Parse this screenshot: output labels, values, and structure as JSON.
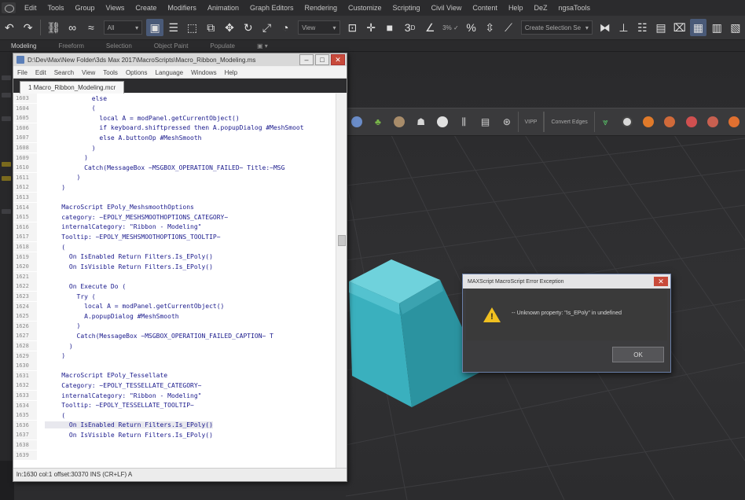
{
  "menubar": {
    "items": [
      "Edit",
      "Tools",
      "Group",
      "Views",
      "Create",
      "Modifiers",
      "Animation",
      "Graph Editors",
      "Rendering",
      "Customize",
      "Scripting",
      "Civil View",
      "Content",
      "Help",
      "DeZ",
      "ngsaTools"
    ]
  },
  "toolbar": {
    "filter_value": "All",
    "view_value": "View",
    "snaps_label": "3",
    "named_selection_value": "Create Selection Se"
  },
  "ribbon_tabs": [
    "Modeling",
    "Freeform",
    "Selection",
    "Object Paint",
    "Populate"
  ],
  "ribbon_row": {
    "btn1": "VIPP",
    "btn2": "Convert Edges"
  },
  "editor": {
    "title": "D:\\Dev\\Max\\New Folder\\3ds Max 2017\\MacroScripts\\Macro_Ribbon_Modeling.ms",
    "menus": [
      "File",
      "Edit",
      "Search",
      "View",
      "Tools",
      "Options",
      "Language",
      "Windows",
      "Help"
    ],
    "tab_label": "1 Macro_Ribbon_Modeling.mcr",
    "status": "ln:1630 col:1 offset:30370 INS (CR+LF) A",
    "lines": [
      {
        "n": "1603",
        "f": "",
        "c": "            else"
      },
      {
        "n": "1604",
        "f": "",
        "c": "            ("
      },
      {
        "n": "1605",
        "f": "",
        "c": "              local A = modPanel.getCurrentObject()"
      },
      {
        "n": "1606",
        "f": "",
        "c": "              if keyboard.shiftpressed then A.popupDialog #MeshSmoot"
      },
      {
        "n": "1607",
        "f": "",
        "c": "              else A.buttonOp #MeshSmooth"
      },
      {
        "n": "1608",
        "f": "",
        "c": "            )"
      },
      {
        "n": "1609",
        "f": "",
        "c": "          )"
      },
      {
        "n": "1610",
        "f": "",
        "c": "          Catch(MessageBox ~MSGBOX_OPERATION_FAILED~ Title:~MSG"
      },
      {
        "n": "1611",
        "f": "",
        "c": "        )"
      },
      {
        "n": "1612",
        "f": "",
        "c": "    )"
      },
      {
        "n": "1613",
        "f": "",
        "c": ""
      },
      {
        "n": "1614",
        "f": "",
        "c": "    MacroScript EPoly_MeshsmoothOptions"
      },
      {
        "n": "1615",
        "f": "",
        "c": "    category: ~EPOLY_MESHSMOOTHOPTIONS_CATEGORY~"
      },
      {
        "n": "1616",
        "f": "",
        "c": "    internalCategory: \"Ribbon - Modeling\""
      },
      {
        "n": "1617",
        "f": "",
        "c": "    Tooltip: ~EPOLY_MESHSMOOTHOPTIONS_TOOLTIP~"
      },
      {
        "n": "1618",
        "f": "",
        "c": "    ("
      },
      {
        "n": "1619",
        "f": "",
        "c": "      On IsEnabled Return Filters.Is_EPoly()"
      },
      {
        "n": "1620",
        "f": "",
        "c": "      On IsVisible Return Filters.Is_EPoly()"
      },
      {
        "n": "1621",
        "f": "",
        "c": ""
      },
      {
        "n": "1622",
        "f": "",
        "c": "      On Execute Do ("
      },
      {
        "n": "1623",
        "f": "",
        "c": "        Try ("
      },
      {
        "n": "1624",
        "f": "",
        "c": "          local A = modPanel.getCurrentObject()"
      },
      {
        "n": "1625",
        "f": "",
        "c": "          A.popupDialog #MeshSmooth"
      },
      {
        "n": "1626",
        "f": "",
        "c": "        )"
      },
      {
        "n": "1627",
        "f": "",
        "c": "        Catch(MessageBox ~MSGBOX_OPERATION_FAILED_CAPTION~ T"
      },
      {
        "n": "1628",
        "f": "",
        "c": "      )"
      },
      {
        "n": "1629",
        "f": "",
        "c": "    )"
      },
      {
        "n": "1630",
        "f": "",
        "c": ""
      },
      {
        "n": "1631",
        "f": "",
        "c": "    MacroScript EPoly_Tessellate"
      },
      {
        "n": "1632",
        "f": "",
        "c": "    Category: ~EPOLY_TESSELLATE_CATEGORY~"
      },
      {
        "n": "1633",
        "f": "",
        "c": "    internalCategory: \"Ribbon - Modeling\""
      },
      {
        "n": "1634",
        "f": "",
        "c": "    Tooltip: ~EPOLY_TESSELLATE_TOOLTIP~"
      },
      {
        "n": "1635",
        "f": "",
        "c": "    ("
      },
      {
        "n": "1636",
        "f": "",
        "c": "      On IsEnabled Return Filters.Is_EPoly()",
        "hl": true
      },
      {
        "n": "1637",
        "f": "",
        "c": "      On IsVisible Return Filters.Is_EPoly()"
      },
      {
        "n": "1638",
        "f": "",
        "c": ""
      },
      {
        "n": "1639",
        "f": "",
        "c": ""
      }
    ]
  },
  "dialog": {
    "title": "MAXScript MacroScript Error Exception",
    "message": "-- Unknown property: \"Is_EPoly\" in undefined",
    "ok_label": "OK"
  },
  "colors": {
    "cube_top": "#5fc8d4",
    "cube_front": "#39aebc",
    "cube_side": "#2a8f9c",
    "warning": "#f0c020"
  }
}
